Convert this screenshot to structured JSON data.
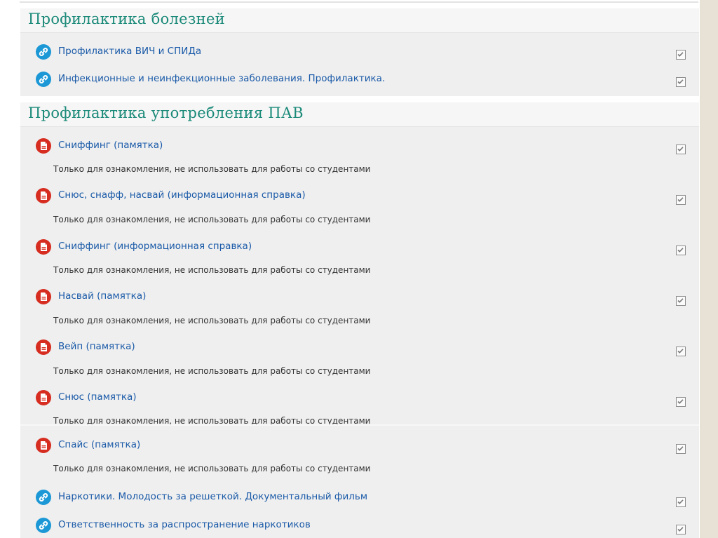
{
  "sections": [
    {
      "title": "Профилактика болезней",
      "items": [
        {
          "type": "url",
          "icon": "link-icon",
          "label": "Профилактика ВИЧ и СПИДа",
          "note": ""
        },
        {
          "type": "url",
          "icon": "link-icon",
          "label": "Инфекционные и неинфекционные заболевания. Профилактика.",
          "note": ""
        }
      ]
    },
    {
      "title": "Профилактика употребления ПАВ",
      "items": [
        {
          "type": "pdf",
          "icon": "pdf-icon",
          "label": "Сниффинг (памятка)",
          "note": "Только для ознакомления, не использовать для работы со студентами"
        },
        {
          "type": "pdf",
          "icon": "pdf-icon",
          "label": "Снюс, снафф, насвай (информационная справка)",
          "note": "Только для ознакомления, не использовать для работы со студентами"
        },
        {
          "type": "pdf",
          "icon": "pdf-icon",
          "label": "Сниффинг (информационная справка)",
          "note": "Только для ознакомления, не использовать для работы со студентами"
        },
        {
          "type": "pdf",
          "icon": "pdf-icon",
          "label": "Насвай (памятка)",
          "note": "Только для ознакомления, не использовать для работы со студентами"
        },
        {
          "type": "pdf",
          "icon": "pdf-icon",
          "label": "Вейп (памятка)",
          "note": "Только для ознакомления, не использовать для работы со студентами"
        },
        {
          "type": "pdf",
          "icon": "pdf-icon",
          "label": "Снюс (памятка)",
          "note": "Только для ознакомления, не использовать для работы со студентами"
        },
        {
          "type": "pdf",
          "icon": "pdf-icon",
          "label": "Спайс (памятка)",
          "note": "Только для ознакомления, не использовать для работы со студентами"
        },
        {
          "type": "url",
          "icon": "link-icon",
          "label": "Наркотики. Молодость за решеткой. Документальный фильм",
          "note": ""
        },
        {
          "type": "url",
          "icon": "link-icon",
          "label": "Ответственность за распространение наркотиков",
          "note": ""
        }
      ]
    }
  ],
  "completion_icon": "checkbox-icon",
  "colors": {
    "section_title": "#1b8a79",
    "link": "#1a5aa8",
    "link_icon": "#1c98d6",
    "pdf_icon": "#d62d20"
  }
}
